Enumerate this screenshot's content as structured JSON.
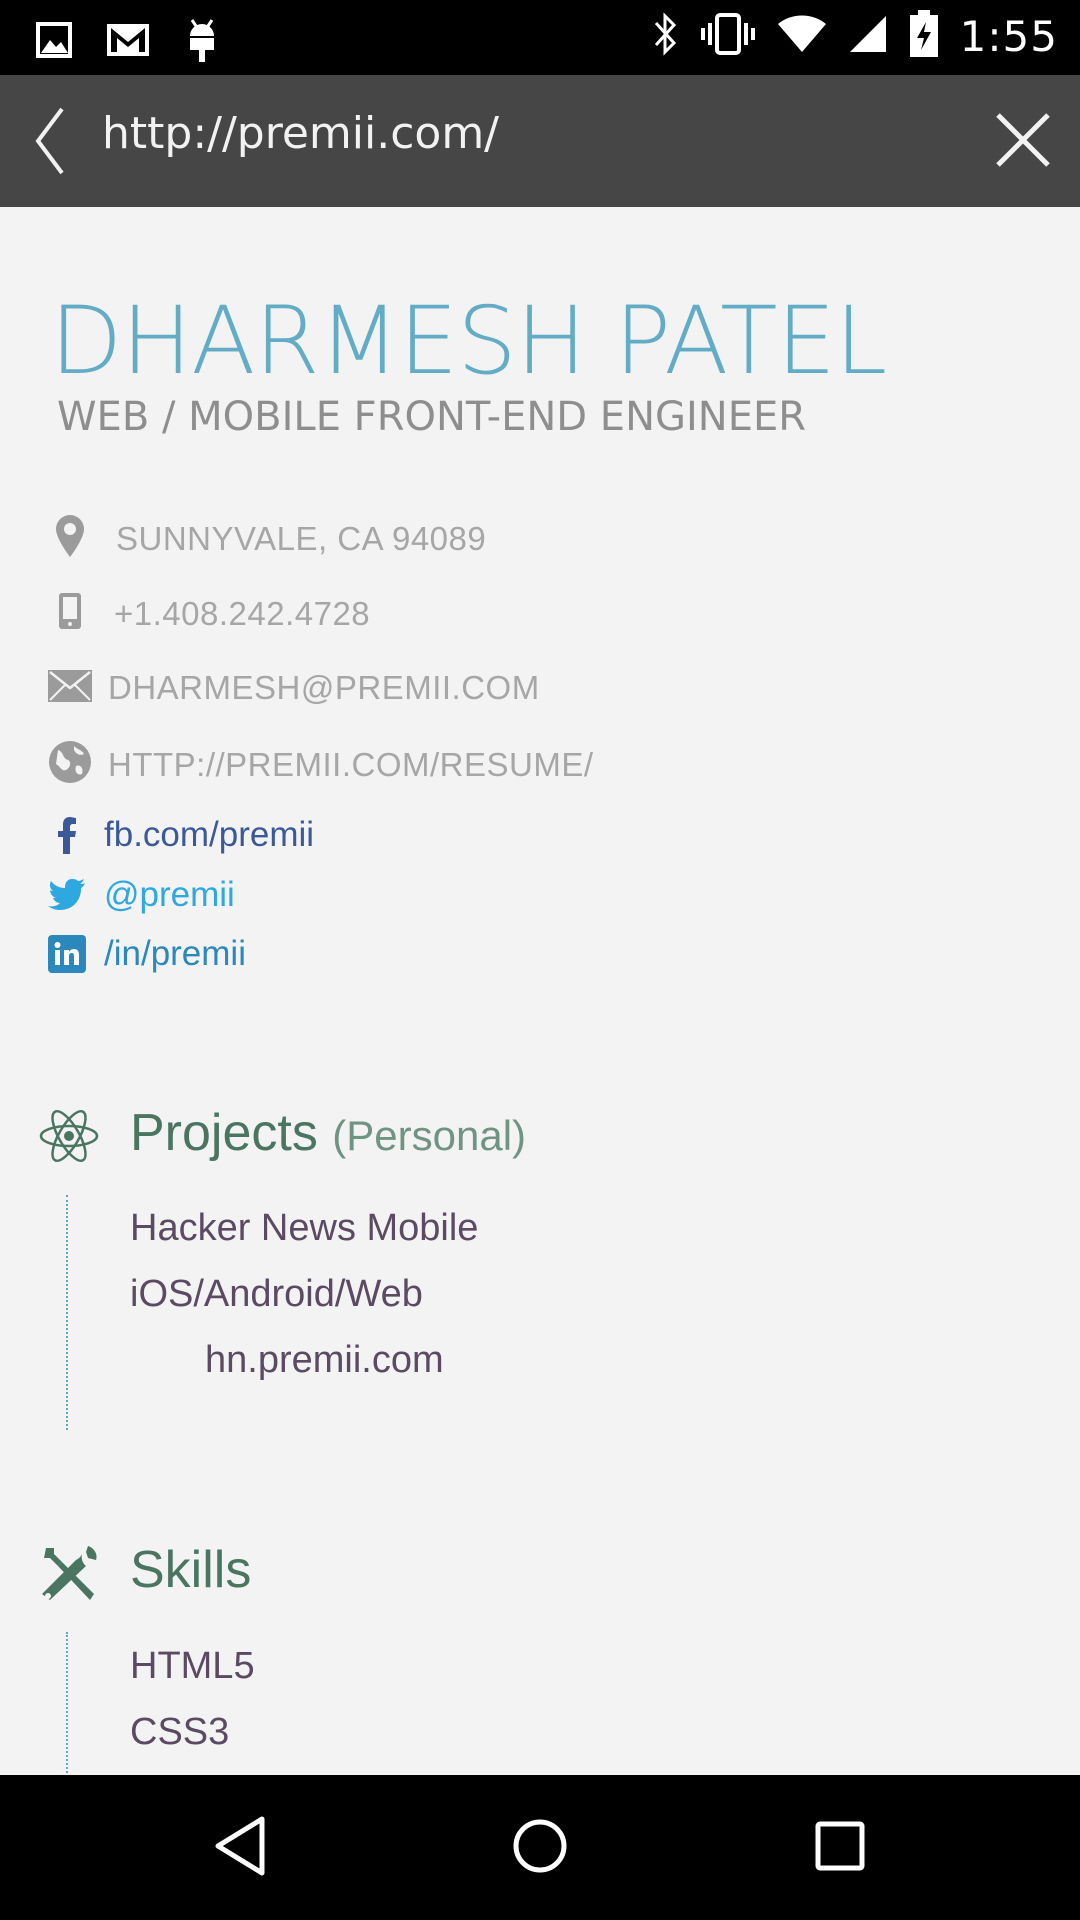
{
  "status_bar": {
    "time": "1:55",
    "left_icons": [
      "gallery-icon",
      "gmail-icon",
      "android-debug-icon"
    ],
    "right_icons": [
      "bluetooth-icon",
      "vibrate-icon",
      "wifi-icon",
      "signal-icon",
      "battery-icon"
    ]
  },
  "browser": {
    "url": "http://premii.com/"
  },
  "profile": {
    "name": "DHARMESH PATEL",
    "role": "WEB / MOBILE FRONT-END ENGINEER",
    "location": "SUNNYVALE, CA 94089",
    "phone": "+1.408.242.4728",
    "email": "DHARMESH@PREMII.COM",
    "website": "HTTP://PREMII.COM/RESUME/"
  },
  "social": {
    "facebook": "fb.com/premii",
    "twitter": "@premii",
    "linkedin": "/in/premii"
  },
  "projects": {
    "title": "Projects",
    "subtitle": "(Personal)",
    "items": [
      "Hacker News Mobile",
      "iOS/Android/Web",
      "hn.premii.com"
    ]
  },
  "skills": {
    "title": "Skills",
    "items": [
      "HTML5",
      "CSS3"
    ]
  },
  "colors": {
    "name": "#62acc6",
    "section_title": "#4a7561",
    "facebook": "#3b5998",
    "twitter": "#2fa8e0",
    "linkedin": "#2b88bd",
    "item_text": "#5a4b62"
  }
}
